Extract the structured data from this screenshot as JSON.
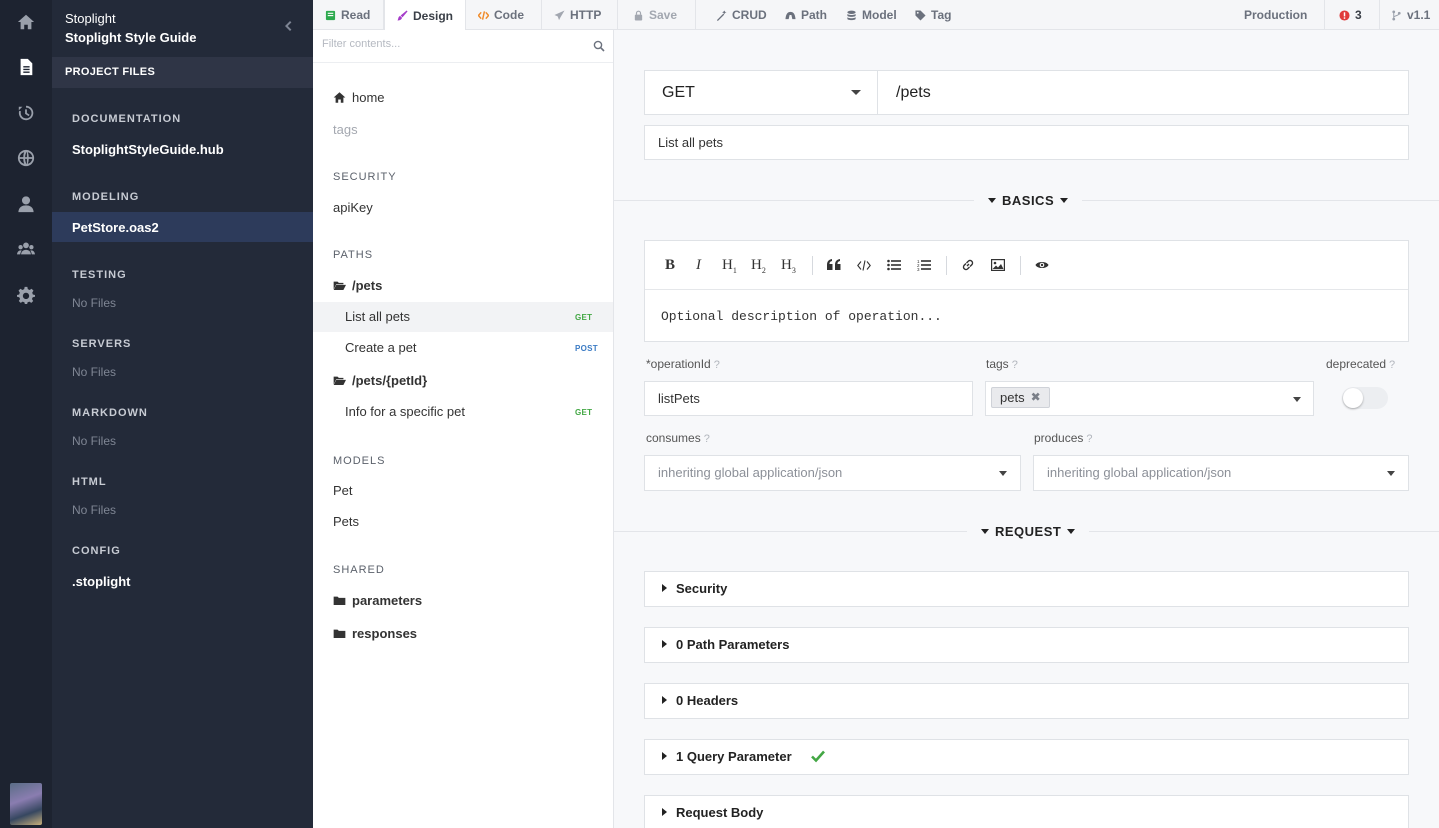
{
  "rail": {
    "icons": [
      "home-icon",
      "file-icon",
      "history-icon",
      "globe-icon",
      "user-icon",
      "team-icon",
      "gear-icon"
    ]
  },
  "project": {
    "org": "Stoplight",
    "name": "Stoplight Style Guide",
    "files_header": "PROJECT FILES",
    "sections": [
      {
        "title": "DOCUMENTATION",
        "file": "StoplightStyleGuide.hub"
      },
      {
        "title": "MODELING",
        "file": "PetStore.oas2"
      },
      {
        "title": "TESTING",
        "empty": "No Files"
      },
      {
        "title": "SERVERS",
        "empty": "No Files"
      },
      {
        "title": "MARKDOWN",
        "empty": "No Files"
      },
      {
        "title": "HTML",
        "empty": "No Files"
      },
      {
        "title": "CONFIG",
        "file": ".stoplight"
      }
    ]
  },
  "tabs": {
    "read": "Read",
    "design": "Design",
    "code": "Code",
    "http": "HTTP",
    "save": "Save",
    "crud": "CRUD",
    "path": "Path",
    "model": "Model",
    "tag": "Tag",
    "env": "Production",
    "errors": "3",
    "version": "v1.1"
  },
  "colors": {
    "read": "#2eaa4f",
    "design": "#a53cc9",
    "code": "#f08c2b",
    "error": "#e03b3b",
    "get": "#43a744",
    "post": "#3b7bc4"
  },
  "tree": {
    "filter_placeholder": "Filter contents...",
    "home": "home",
    "tags": "tags",
    "security_header": "SECURITY",
    "security_item": "apiKey",
    "paths_header": "PATHS",
    "path1": "/pets",
    "op1": "List all pets",
    "op1_method": "GET",
    "op2": "Create a pet",
    "op2_method": "POST",
    "path2": "/pets/{petId}",
    "op3": "Info for a specific pet",
    "op3_method": "GET",
    "models_header": "MODELS",
    "model1": "Pet",
    "model2": "Pets",
    "shared_header": "SHARED",
    "shared1": "parameters",
    "shared2": "responses"
  },
  "main": {
    "method": "GET",
    "path": "/pets",
    "summary": "List all pets",
    "basics": "BASICS",
    "request": "REQUEST",
    "editor": {
      "tools": [
        "B",
        "I",
        "H",
        "H",
        "H"
      ],
      "h_subs": [
        "1",
        "2",
        "3"
      ],
      "description_placeholder": "Optional description of operation..."
    },
    "operationId_label": "*operationId",
    "operationId_value": "listPets",
    "tags_label": "tags",
    "tag_chip": "pets",
    "deprecated_label": "deprecated",
    "consumes_label": "consumes",
    "consumes_value": "inheriting global application/json",
    "produces_label": "produces",
    "produces_value": "inheriting global application/json",
    "help": "?",
    "sections": [
      "Security",
      "0 Path Parameters",
      "0 Headers",
      "1 Query Parameter",
      "Request Body"
    ]
  }
}
